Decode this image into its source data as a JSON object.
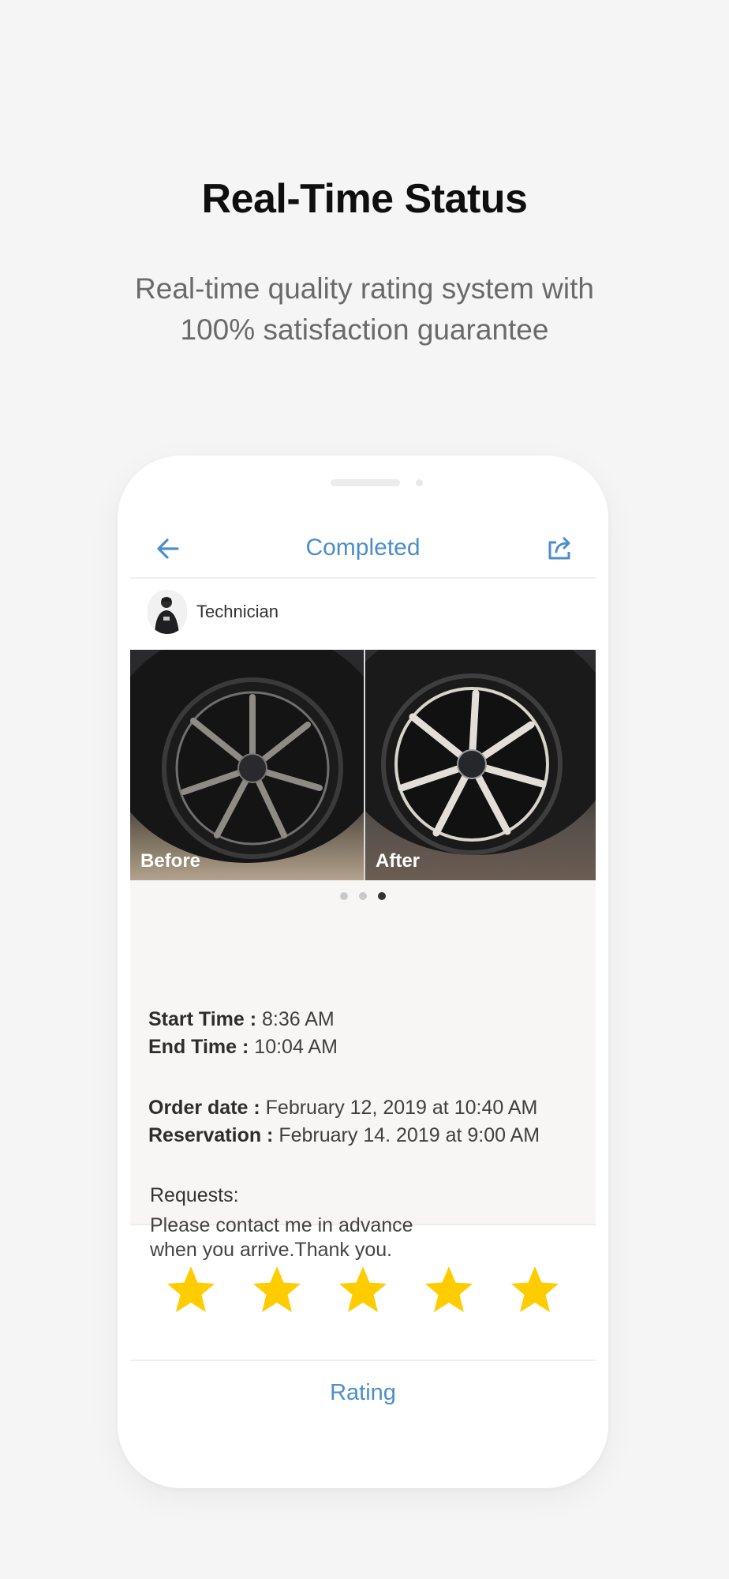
{
  "headline": "Real-Time Status",
  "subline": {
    "line1": "Real-time quality rating system with",
    "line2": "100% satisfaction guarantee"
  },
  "nav": {
    "title": "Completed",
    "back_icon": "arrow-left-icon",
    "share_icon": "share-icon"
  },
  "technician": {
    "label": "Technician"
  },
  "photos": {
    "before_label": "Before",
    "after_label": "After",
    "page_count": 3,
    "active_page": 3
  },
  "details": {
    "start_key": "Start Time :",
    "start_value": "8:36 AM",
    "end_key": "End Time :",
    "end_value": "10:04 AM",
    "order_key": "Order date :",
    "order_value": "February 12, 2019 at 10:40 AM",
    "reservation_key": "Reservation :",
    "reservation_value": "February 14. 2019 at 9:00 AM",
    "requests_title": "Requests:",
    "requests_line1": "Please contact me in advance",
    "requests_line2": "when you arrive.Thank you."
  },
  "rating": {
    "stars": 5,
    "max": 5,
    "label": "Rating"
  },
  "colors": {
    "accent": "#4d8ec9",
    "star": "#ffcc00",
    "background": "#f5f5f5"
  }
}
